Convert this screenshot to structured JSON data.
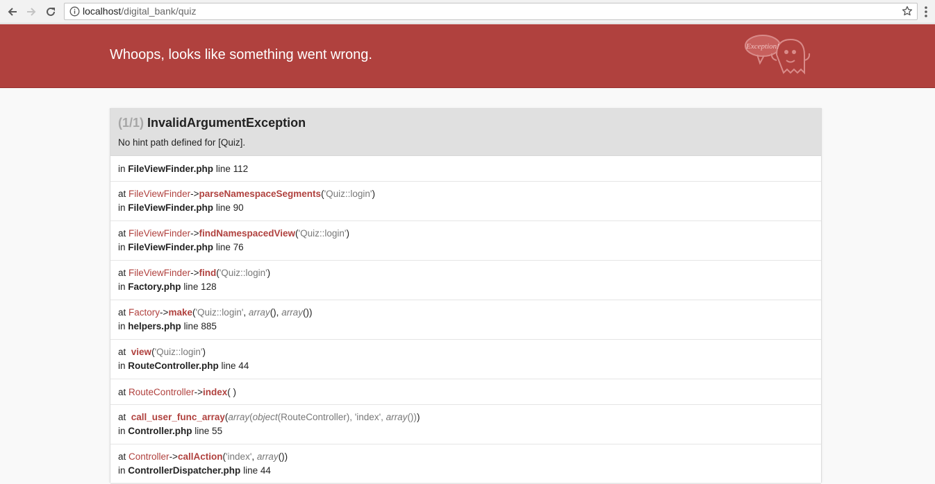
{
  "browser": {
    "url_host": "localhost",
    "url_path": "/digital_bank/quiz"
  },
  "header": {
    "title": "Whoops, looks like something went wrong.",
    "logo_text": "Exception!"
  },
  "exception": {
    "count": "(1/1)",
    "class": "InvalidArgumentException",
    "message": "No hint path defined for [Quiz]."
  },
  "trace": [
    {
      "file": "FileViewFinder.php",
      "line": "line 112"
    },
    {
      "class": "FileViewFinder",
      "method": "parseNamespaceSegments",
      "args": "'Quiz::login'",
      "file": "FileViewFinder.php",
      "line": "line 90"
    },
    {
      "class": "FileViewFinder",
      "method": "findNamespacedView",
      "args": "'Quiz::login'",
      "file": "FileViewFinder.php",
      "line": "line 76"
    },
    {
      "class": "FileViewFinder",
      "method": "find",
      "args": "'Quiz::login'",
      "file": "Factory.php",
      "line": "line 128"
    },
    {
      "class": "Factory",
      "method": "make",
      "args": "'Quiz::login'",
      "args2": "array",
      "args3": "array",
      "file": "helpers.php",
      "line": "line 885"
    },
    {
      "method": "view",
      "args": "'Quiz::login'",
      "file": "RouteController.php",
      "line": "line 44"
    },
    {
      "class": "RouteController",
      "method": "index"
    },
    {
      "method": "call_user_func_array",
      "args_a": "array",
      "args_b": "object",
      "args_c": "RouteController",
      "args_d": "'index'",
      "args_e": "array",
      "file": "Controller.php",
      "line": "line 55"
    },
    {
      "class": "Controller",
      "method": "callAction",
      "args": "'index'",
      "args2": "array",
      "file": "ControllerDispatcher.php",
      "line": "line 44"
    }
  ],
  "labels": {
    "in": "in",
    "at": "at",
    "arrow": "->"
  },
  "colors": {
    "header_bg": "#b0413e",
    "accent": "#b0413e"
  }
}
